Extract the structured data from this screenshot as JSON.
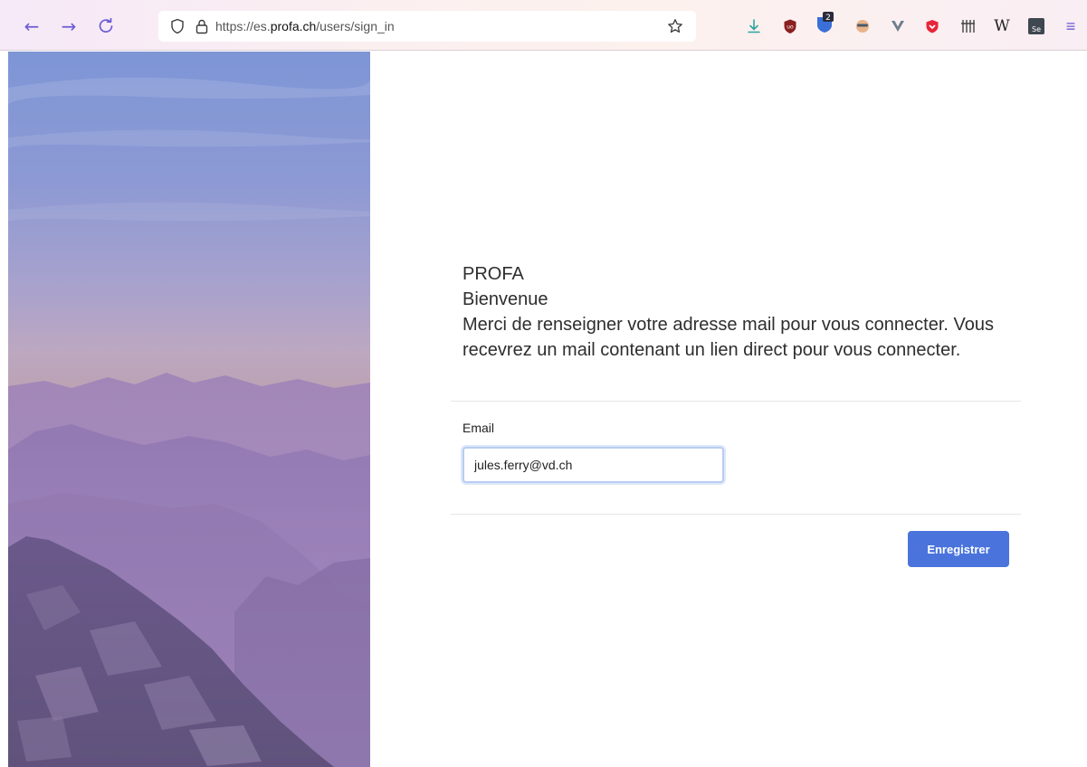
{
  "browser": {
    "url_prefix": "https://es.",
    "url_host": "profa.ch",
    "url_path": "/users/sign_in",
    "back_glyph": "←",
    "forward_glyph": "→",
    "reload_glyph": "C",
    "extension_badge": "2",
    "ext_w_label": "W",
    "ext_se_label": "Se",
    "menu_glyph": "≡"
  },
  "page": {
    "org_name": "PROFA",
    "welcome": "Bienvenue",
    "instructions": "Merci de renseigner votre adresse mail pour vous connecter. Vous recevrez un mail contenant un lien direct pour vous connecter.",
    "email_label": "Email",
    "email_value": "jules.ferry@vd.ch",
    "submit_label": "Enregistrer"
  },
  "colors": {
    "accent": "#4a74dc",
    "nav_icons": "#6b5bd6"
  }
}
